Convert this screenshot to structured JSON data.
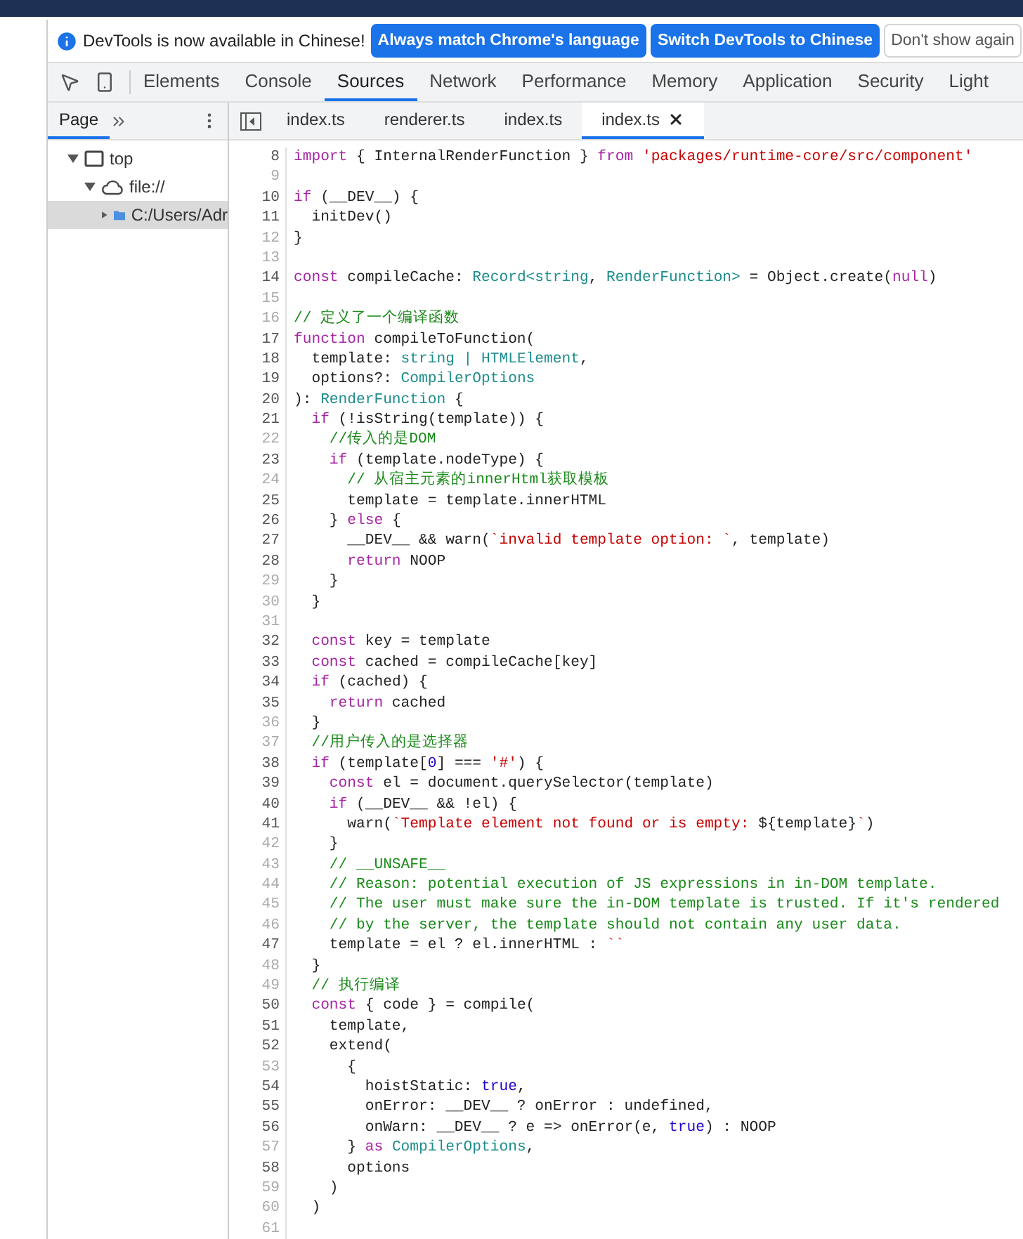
{
  "infobar": {
    "message": "DevTools is now available in Chinese!",
    "buttons": [
      {
        "label": "Always match Chrome's language",
        "kind": "primary"
      },
      {
        "label": "Switch DevTools to Chinese",
        "kind": "primary"
      },
      {
        "label": "Don't show again",
        "kind": "secondary"
      }
    ]
  },
  "toolbar": {
    "tabs": [
      {
        "label": "Elements",
        "selected": false
      },
      {
        "label": "Console",
        "selected": false
      },
      {
        "label": "Sources",
        "selected": true
      },
      {
        "label": "Network",
        "selected": false
      },
      {
        "label": "Performance",
        "selected": false
      },
      {
        "label": "Memory",
        "selected": false
      },
      {
        "label": "Application",
        "selected": false
      },
      {
        "label": "Security",
        "selected": false
      },
      {
        "label": "Light",
        "selected": false
      }
    ]
  },
  "navigator": {
    "tabs": [
      {
        "label": "Page",
        "selected": true
      }
    ],
    "tree": [
      {
        "label": "top",
        "kind": "frame",
        "expanded": true,
        "selected": false,
        "children": [
          {
            "label": "file://",
            "kind": "origin",
            "expanded": true,
            "selected": false,
            "children": [
              {
                "label": "C:/Users/Adr",
                "kind": "folder",
                "expanded": false,
                "selected": true
              }
            ]
          }
        ]
      }
    ]
  },
  "editor": {
    "tabs": [
      {
        "label": "index.ts",
        "selected": false
      },
      {
        "label": "renderer.ts",
        "selected": false
      },
      {
        "label": "index.ts",
        "selected": false
      },
      {
        "label": "index.ts",
        "selected": true
      }
    ],
    "lines": [
      {
        "n": "8",
        "dim": false,
        "tokens": [
          {
            "kind": "kw",
            "text": "import"
          },
          {
            "kind": "p",
            "text": " { InternalRenderFunction } "
          },
          {
            "kind": "kw",
            "text": "from "
          },
          {
            "kind": "str",
            "text": "'packages/runtime-core/src/component'"
          }
        ]
      },
      {
        "n": "9",
        "dim": true
      },
      {
        "n": "10",
        "dim": false,
        "tokens": [
          {
            "kind": "kw",
            "text": "if"
          },
          {
            "kind": "p",
            "text": " (__DEV__) {"
          }
        ]
      },
      {
        "n": "11",
        "dim": false,
        "tokens": [
          {
            "kind": "p",
            "text": "  initDev()"
          }
        ]
      },
      {
        "n": "12",
        "dim": true,
        "tokens": [
          {
            "kind": "p",
            "text": "}"
          }
        ]
      },
      {
        "n": "13",
        "dim": true
      },
      {
        "n": "14",
        "dim": false,
        "tokens": [
          {
            "kind": "kw",
            "text": "const"
          },
          {
            "kind": "p",
            "text": " compileCache: "
          },
          {
            "kind": "type",
            "text": "Record<string"
          },
          {
            "kind": "p",
            "text": ", "
          },
          {
            "kind": "type",
            "text": "RenderFunction>"
          },
          {
            "kind": "p",
            "text": " = Object.create("
          },
          {
            "kind": "kw",
            "text": "null"
          },
          {
            "kind": "p",
            "text": ")"
          }
        ]
      },
      {
        "n": "15",
        "dim": true
      },
      {
        "n": "16",
        "dim": true,
        "tokens": [
          {
            "kind": "cm",
            "text": "// 定义了一个编译函数"
          }
        ]
      },
      {
        "n": "17",
        "dim": false,
        "tokens": [
          {
            "kind": "kw",
            "text": "function"
          },
          {
            "kind": "p",
            "text": " compileToFunction("
          }
        ]
      },
      {
        "n": "18",
        "dim": false,
        "tokens": [
          {
            "kind": "p",
            "text": "  template: "
          },
          {
            "kind": "type",
            "text": "string | HTMLElement"
          },
          {
            "kind": "p",
            "text": ","
          }
        ]
      },
      {
        "n": "19",
        "dim": false,
        "tokens": [
          {
            "kind": "p",
            "text": "  options?: "
          },
          {
            "kind": "type",
            "text": "CompilerOptions"
          }
        ]
      },
      {
        "n": "20",
        "dim": false,
        "tokens": [
          {
            "kind": "p",
            "text": "): "
          },
          {
            "kind": "type",
            "text": "RenderFunction"
          },
          {
            "kind": "p",
            "text": " {"
          }
        ]
      },
      {
        "n": "21",
        "dim": false,
        "tokens": [
          {
            "kind": "kw",
            "text": "  if"
          },
          {
            "kind": "p",
            "text": " (!isString(template)) {"
          }
        ]
      },
      {
        "n": "22",
        "dim": true,
        "tokens": [
          {
            "kind": "cm",
            "text": "    //传入的是DOM"
          }
        ]
      },
      {
        "n": "23",
        "dim": false,
        "tokens": [
          {
            "kind": "kw",
            "text": "    if"
          },
          {
            "kind": "p",
            "text": " (template.nodeType) {"
          }
        ]
      },
      {
        "n": "24",
        "dim": true,
        "tokens": [
          {
            "kind": "cm",
            "text": "      // 从宿主元素的innerHtml获取模板"
          }
        ]
      },
      {
        "n": "25",
        "dim": false,
        "tokens": [
          {
            "kind": "p",
            "text": "      template = template.innerHTML"
          }
        ]
      },
      {
        "n": "26",
        "dim": false,
        "tokens": [
          {
            "kind": "p",
            "text": "    } "
          },
          {
            "kind": "kw",
            "text": "else"
          },
          {
            "kind": "p",
            "text": " {"
          }
        ]
      },
      {
        "n": "27",
        "dim": false,
        "tokens": [
          {
            "kind": "p",
            "text": "      __DEV__ && warn("
          },
          {
            "kind": "str",
            "text": "`invalid template option: `"
          },
          {
            "kind": "p",
            "text": ", template)"
          }
        ]
      },
      {
        "n": "28",
        "dim": false,
        "tokens": [
          {
            "kind": "kw",
            "text": "      return"
          },
          {
            "kind": "p",
            "text": " NOOP"
          }
        ]
      },
      {
        "n": "29",
        "dim": true,
        "tokens": [
          {
            "kind": "p",
            "text": "    }"
          }
        ]
      },
      {
        "n": "30",
        "dim": true,
        "tokens": [
          {
            "kind": "p",
            "text": "  }"
          }
        ]
      },
      {
        "n": "31",
        "dim": true
      },
      {
        "n": "32",
        "dim": false,
        "tokens": [
          {
            "kind": "kw",
            "text": "  const"
          },
          {
            "kind": "p",
            "text": " key = template"
          }
        ]
      },
      {
        "n": "33",
        "dim": false,
        "tokens": [
          {
            "kind": "kw",
            "text": "  const"
          },
          {
            "kind": "p",
            "text": " cached = compileCache[key]"
          }
        ]
      },
      {
        "n": "34",
        "dim": false,
        "tokens": [
          {
            "kind": "kw",
            "text": "  if"
          },
          {
            "kind": "p",
            "text": " (cached) {"
          }
        ]
      },
      {
        "n": "35",
        "dim": false,
        "tokens": [
          {
            "kind": "kw",
            "text": "    return"
          },
          {
            "kind": "p",
            "text": " cached"
          }
        ]
      },
      {
        "n": "36",
        "dim": true,
        "tokens": [
          {
            "kind": "p",
            "text": "  }"
          }
        ]
      },
      {
        "n": "37",
        "dim": true,
        "tokens": [
          {
            "kind": "cm",
            "text": "  //用户传入的是选择器"
          }
        ]
      },
      {
        "n": "38",
        "dim": false,
        "tokens": [
          {
            "kind": "kw",
            "text": "  if"
          },
          {
            "kind": "p",
            "text": " (template["
          },
          {
            "kind": "num",
            "text": "0"
          },
          {
            "kind": "p",
            "text": "] === "
          },
          {
            "kind": "str",
            "text": "'#'"
          },
          {
            "kind": "p",
            "text": ") {"
          }
        ]
      },
      {
        "n": "39",
        "dim": false,
        "tokens": [
          {
            "kind": "kw",
            "text": "    const"
          },
          {
            "kind": "p",
            "text": " el = document.querySelector(template)"
          }
        ]
      },
      {
        "n": "40",
        "dim": false,
        "tokens": [
          {
            "kind": "kw",
            "text": "    if"
          },
          {
            "kind": "p",
            "text": " (__DEV__ && !el) {"
          }
        ]
      },
      {
        "n": "41",
        "dim": false,
        "tokens": [
          {
            "kind": "p",
            "text": "      warn("
          },
          {
            "kind": "str",
            "text": "`Template element not found or is empty: "
          },
          {
            "kind": "p",
            "text": "${template}"
          },
          {
            "kind": "str",
            "text": "`"
          },
          {
            "kind": "p",
            "text": ")"
          }
        ]
      },
      {
        "n": "42",
        "dim": true,
        "tokens": [
          {
            "kind": "p",
            "text": "    }"
          }
        ]
      },
      {
        "n": "43",
        "dim": true,
        "tokens": [
          {
            "kind": "cm",
            "text": "    // __UNSAFE__"
          }
        ]
      },
      {
        "n": "44",
        "dim": true,
        "tokens": [
          {
            "kind": "cm",
            "text": "    // Reason: potential execution of JS expressions in in-DOM template."
          }
        ]
      },
      {
        "n": "45",
        "dim": true,
        "tokens": [
          {
            "kind": "cm",
            "text": "    // The user must make sure the in-DOM template is trusted. If it's rendered"
          }
        ]
      },
      {
        "n": "46",
        "dim": true,
        "tokens": [
          {
            "kind": "cm",
            "text": "    // by the server, the template should not contain any user data."
          }
        ]
      },
      {
        "n": "47",
        "dim": false,
        "tokens": [
          {
            "kind": "p",
            "text": "    template = el ? el.innerHTML : "
          },
          {
            "kind": "str",
            "text": "``"
          }
        ]
      },
      {
        "n": "48",
        "dim": true,
        "tokens": [
          {
            "kind": "p",
            "text": "  }"
          }
        ]
      },
      {
        "n": "49",
        "dim": true,
        "tokens": [
          {
            "kind": "cm",
            "text": "  // 执行编译"
          }
        ]
      },
      {
        "n": "50",
        "dim": false,
        "tokens": [
          {
            "kind": "kw",
            "text": "  const"
          },
          {
            "kind": "p",
            "text": " { code } = compile("
          }
        ]
      },
      {
        "n": "51",
        "dim": false,
        "tokens": [
          {
            "kind": "p",
            "text": "    template,"
          }
        ]
      },
      {
        "n": "52",
        "dim": false,
        "tokens": [
          {
            "kind": "p",
            "text": "    extend("
          }
        ]
      },
      {
        "n": "53",
        "dim": true,
        "tokens": [
          {
            "kind": "p",
            "text": "      {"
          }
        ]
      },
      {
        "n": "54",
        "dim": false,
        "tokens": [
          {
            "kind": "p",
            "text": "        hoistStatic: "
          },
          {
            "kind": "num",
            "text": "true"
          },
          {
            "kind": "p",
            "text": ","
          }
        ]
      },
      {
        "n": "55",
        "dim": false,
        "tokens": [
          {
            "kind": "p",
            "text": "        onError: __DEV__ ? onError : undefined,"
          }
        ]
      },
      {
        "n": "56",
        "dim": false,
        "tokens": [
          {
            "kind": "p",
            "text": "        onWarn: __DEV__ ? e => onError(e, "
          },
          {
            "kind": "num",
            "text": "true"
          },
          {
            "kind": "p",
            "text": ") : NOOP"
          }
        ]
      },
      {
        "n": "57",
        "dim": true,
        "tokens": [
          {
            "kind": "p",
            "text": "      } "
          },
          {
            "kind": "kw",
            "text": "as "
          },
          {
            "kind": "type",
            "text": "CompilerOptions"
          },
          {
            "kind": "p",
            "text": ","
          }
        ]
      },
      {
        "n": "58",
        "dim": false,
        "tokens": [
          {
            "kind": "p",
            "text": "      options"
          }
        ]
      },
      {
        "n": "59",
        "dim": true,
        "tokens": [
          {
            "kind": "p",
            "text": "    )"
          }
        ]
      },
      {
        "n": "60",
        "dim": true,
        "tokens": [
          {
            "kind": "p",
            "text": "  )"
          }
        ]
      },
      {
        "n": "61",
        "dim": true
      }
    ]
  }
}
